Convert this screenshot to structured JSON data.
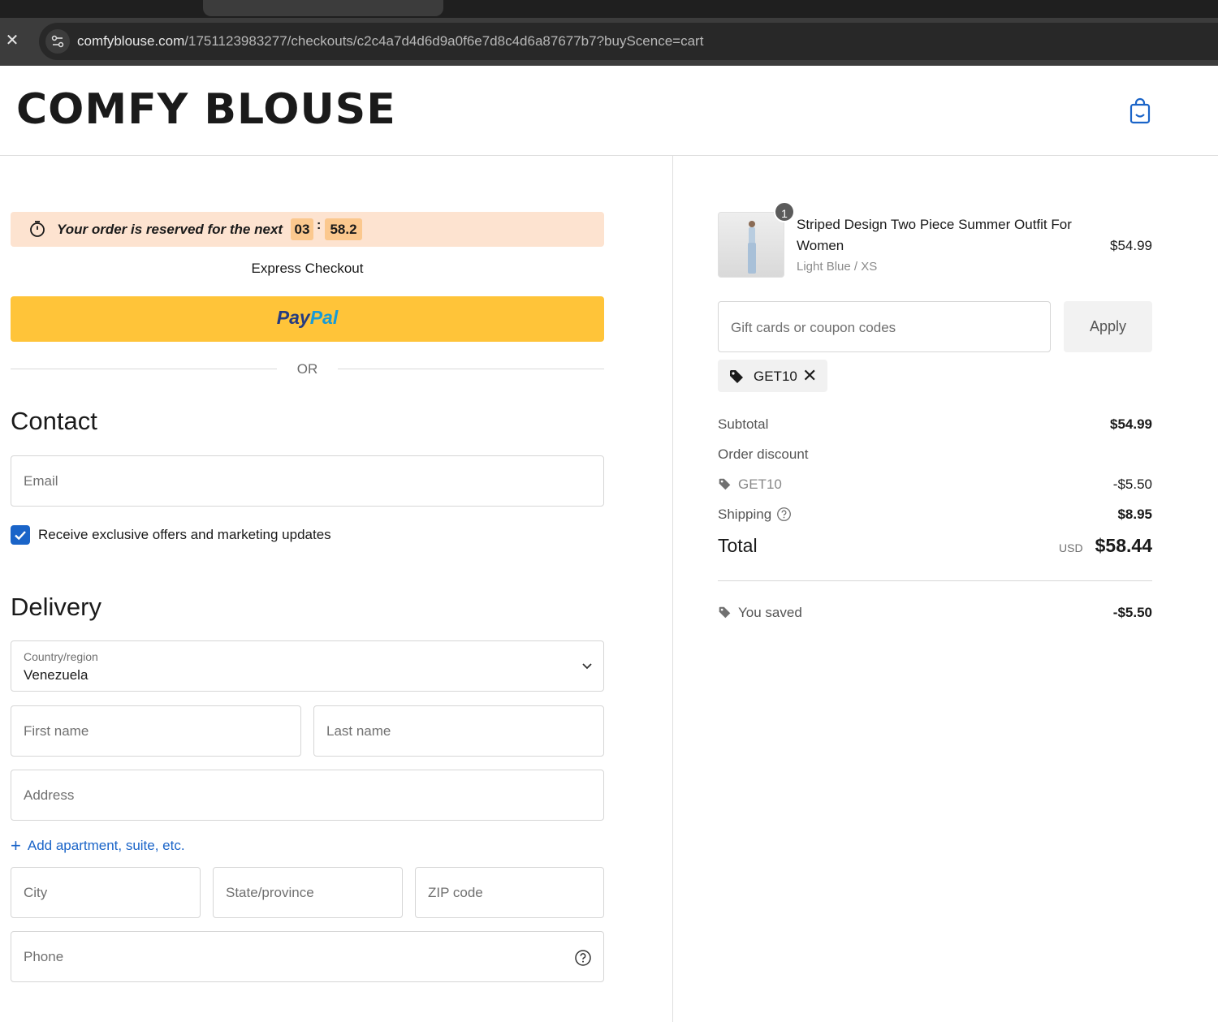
{
  "browser": {
    "url_host": "comfyblouse.com",
    "url_path": "/1751123983277/checkouts/c2c4a7d4d6d9a0f6e7d8c4d6a87677b7?buyScence=cart"
  },
  "store": {
    "logo": "COMFY BLOUSE"
  },
  "timer": {
    "text": "Your order is reserved for the next",
    "minutes": "03",
    "colon": ":",
    "seconds": "58.2"
  },
  "express": {
    "label": "Express Checkout",
    "paypal_pay": "Pay",
    "paypal_pal": "Pal",
    "or": "OR"
  },
  "contact": {
    "title": "Contact",
    "email_placeholder": "Email",
    "marketing_label": "Receive exclusive offers and marketing updates",
    "marketing_checked": true
  },
  "delivery": {
    "title": "Delivery",
    "country_label": "Country/region",
    "country_value": "Venezuela",
    "first_name": "First name",
    "last_name": "Last name",
    "address": "Address",
    "add_apartment": "Add apartment, suite, etc.",
    "city": "City",
    "state": "State/province",
    "zip": "ZIP code",
    "phone": "Phone"
  },
  "summary": {
    "product": {
      "name": "Striped Design Two Piece Summer Outfit For Women",
      "variant": "Light Blue / XS",
      "price": "$54.99",
      "quantity": "1"
    },
    "coupon_placeholder": "Gift cards or coupon codes",
    "apply_label": "Apply",
    "applied_code": "GET10",
    "subtotal_label": "Subtotal",
    "subtotal_value": "$54.99",
    "discount_label": "Order discount",
    "discount_code": "GET10",
    "discount_value": "-$5.50",
    "shipping_label": "Shipping",
    "shipping_value": "$8.95",
    "total_label": "Total",
    "total_currency": "USD",
    "total_value": "$58.44",
    "saved_label": "You saved",
    "saved_value": "-$5.50"
  },
  "colors": {
    "accent": "#1a64c8",
    "timer_bg": "#fde3d0",
    "paypal": "#ffc439"
  }
}
